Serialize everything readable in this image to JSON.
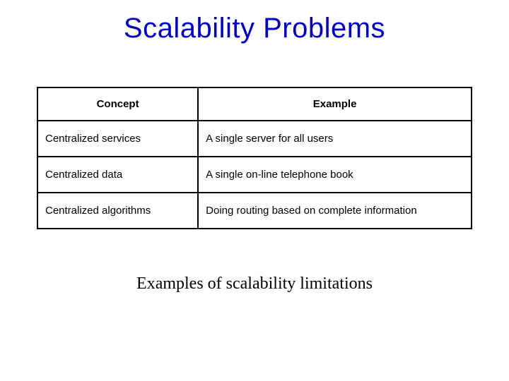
{
  "title": "Scalability Problems",
  "table": {
    "headers": {
      "concept": "Concept",
      "example": "Example"
    },
    "rows": [
      {
        "concept": "Centralized services",
        "example": "A single server for all users"
      },
      {
        "concept": "Centralized data",
        "example": "A single on-line telephone book"
      },
      {
        "concept": "Centralized algorithms",
        "example": "Doing routing based on complete information"
      }
    ]
  },
  "caption": "Examples of scalability limitations"
}
